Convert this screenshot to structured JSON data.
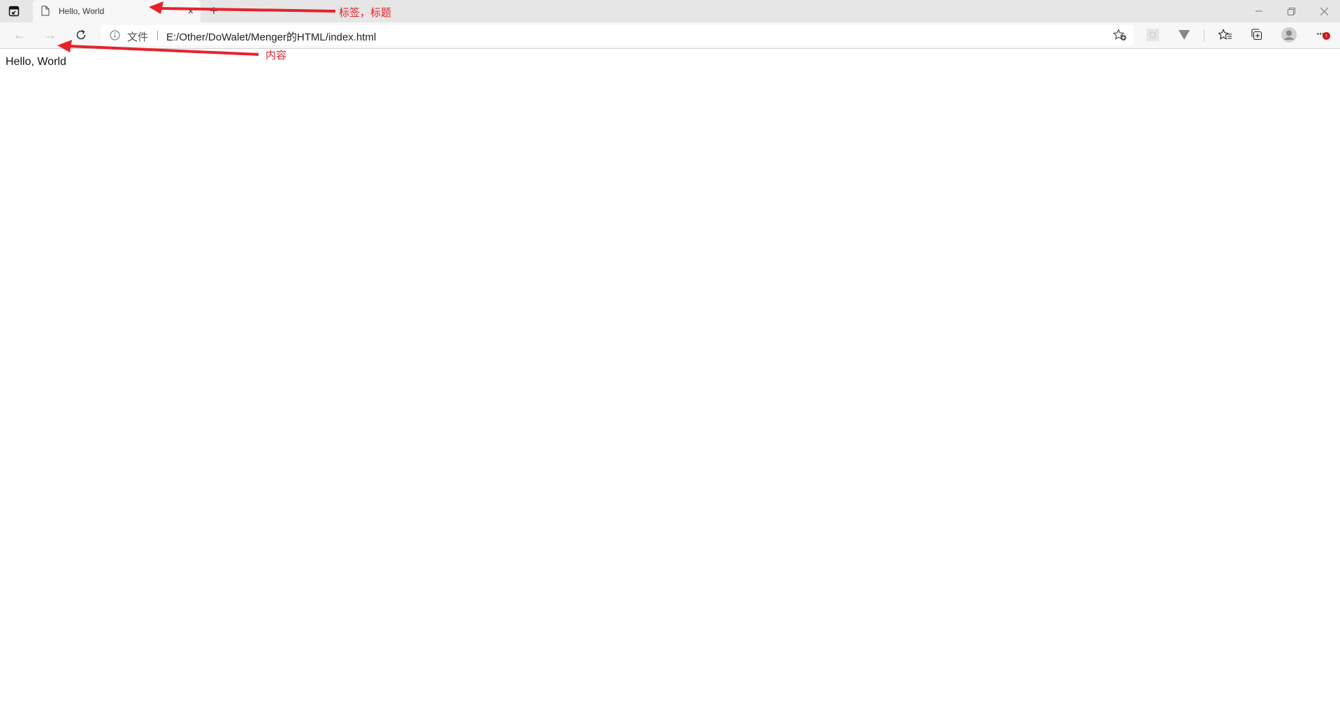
{
  "browser": {
    "tab": {
      "title": "Hello, World",
      "close_glyph": "×"
    },
    "new_tab_glyph": "+",
    "window_controls": {
      "minimize": "—",
      "restore": "❐",
      "close": "✕"
    },
    "nav": {
      "back": "←",
      "forward": "→",
      "reload": "↻"
    },
    "address_bar": {
      "scheme_label": "文件",
      "url": "E:/Other/DoWalet/Menger的HTML/index.html"
    },
    "toolbar_icons": [
      "add-favorite-icon",
      "extension-icon",
      "vimium-icon",
      "favorites-icon",
      "collections-icon",
      "profile-icon",
      "more-icon"
    ],
    "more_glyph": "···",
    "update_badge_glyph": "↑"
  },
  "page": {
    "content_text": "Hello, World"
  },
  "annotations": {
    "tab_label": "标签，标题",
    "content_label": "内容",
    "color": "#e8222a"
  }
}
